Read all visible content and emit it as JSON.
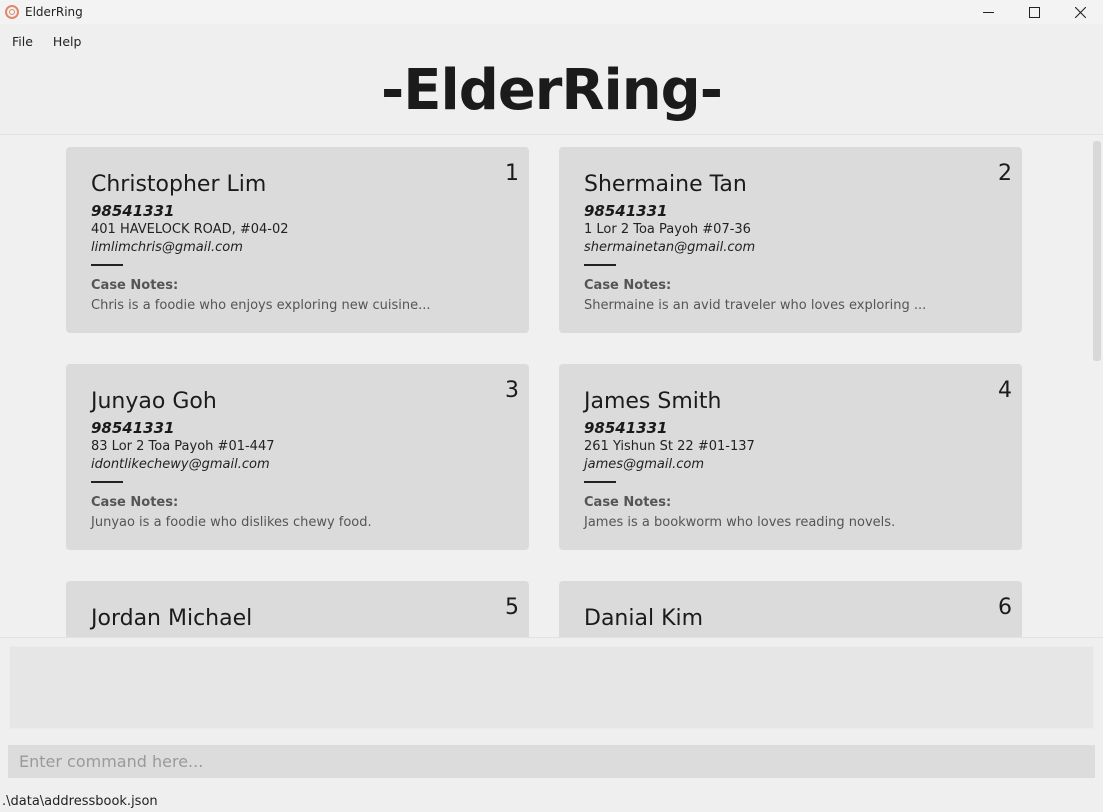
{
  "window": {
    "title": "ElderRing",
    "controls": {
      "minimize": "—",
      "maximize": "☐",
      "close": "✕"
    }
  },
  "menu": {
    "items": [
      "File",
      "Help"
    ]
  },
  "header": {
    "title": "-ElderRing-"
  },
  "notes_label": "Case Notes:",
  "persons": [
    {
      "index": "1",
      "name": "Christopher Lim",
      "phone": "98541331",
      "address": "401 HAVELOCK ROAD, #04-02",
      "email": "limlimchris@gmail.com",
      "notes": "Chris is a foodie who enjoys exploring new cuisine..."
    },
    {
      "index": "2",
      "name": "Shermaine Tan",
      "phone": "98541331",
      "address": "1 Lor 2 Toa Payoh #07-36",
      "email": "shermainetan@gmail.com",
      "notes": "Shermaine is an avid traveler who loves exploring ..."
    },
    {
      "index": "3",
      "name": "Junyao Goh",
      "phone": "98541331",
      "address": "83 Lor 2 Toa Payoh #01-447",
      "email": "idontlikechewy@gmail.com",
      "notes": "Junyao is a foodie who dislikes chewy food."
    },
    {
      "index": "4",
      "name": "James Smith",
      "phone": "98541331",
      "address": "261 Yishun St 22 #01-137",
      "email": "james@gmail.com",
      "notes": "James is a bookworm who loves reading novels."
    },
    {
      "index": "5",
      "name": "Jordan Michael"
    },
    {
      "index": "6",
      "name": "Danial Kim"
    }
  ],
  "result": {
    "text": ""
  },
  "command": {
    "placeholder": "Enter command here..."
  },
  "status": {
    "path": ".\\data\\addressbook.json"
  }
}
